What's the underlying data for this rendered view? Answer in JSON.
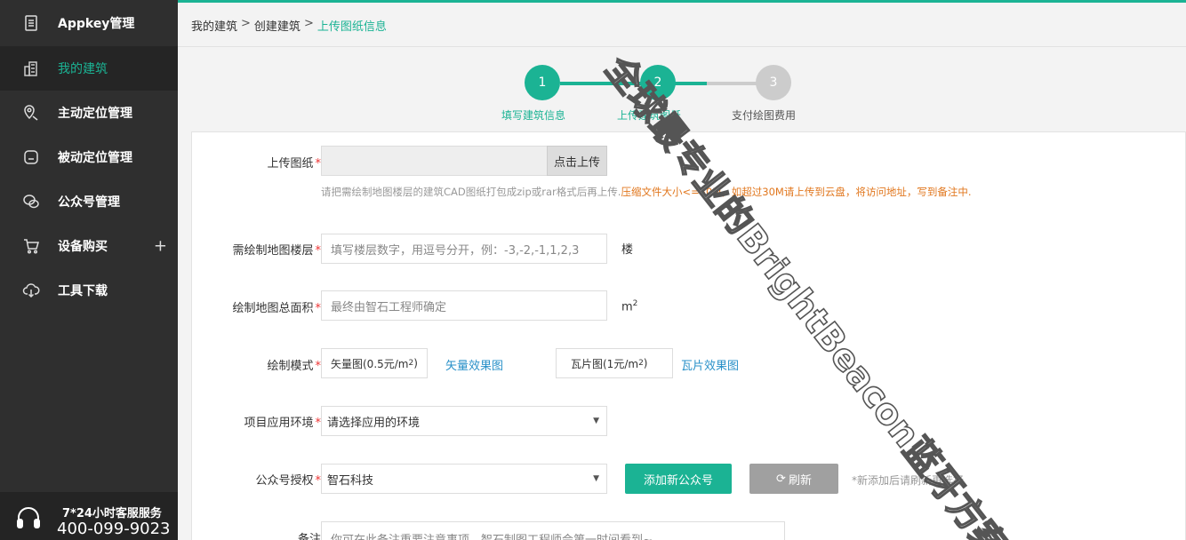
{
  "sidebar": {
    "items": [
      {
        "label": "Appkey管理",
        "icon": "document-icon"
      },
      {
        "label": "我的建筑",
        "icon": "building-icon"
      },
      {
        "label": "主动定位管理",
        "icon": "location-pin-icon"
      },
      {
        "label": "被动定位管理",
        "icon": "beacon-device-icon"
      },
      {
        "label": "公众号管理",
        "icon": "wechat-icon"
      },
      {
        "label": "设备购买",
        "icon": "cart-icon",
        "expand": "+"
      },
      {
        "label": "工具下载",
        "icon": "cloud-download-icon"
      }
    ],
    "service": {
      "title": "7*24小时客服服务",
      "phone": "400-099-9023"
    }
  },
  "breadcrumb": {
    "items": [
      "我的建筑",
      "创建建筑"
    ],
    "separator": ">",
    "current": "上传图纸信息"
  },
  "steps": [
    {
      "number": "1",
      "label": "填写建筑信息",
      "status": "done"
    },
    {
      "number": "2",
      "label": "上传建筑图纸",
      "status": "active"
    },
    {
      "number": "3",
      "label": "支付绘图费用",
      "status": "pending"
    }
  ],
  "form": {
    "upload": {
      "label": "上传图纸",
      "required": "*",
      "button": "点击上传",
      "hint": "请把需绘制地图楼层的建筑CAD图纸打包成zip或rar格式后再上传.",
      "hint_warn": "压缩文件大小<=30M，如超过30M请上传到云盘，将访问地址，写到备注中."
    },
    "floors": {
      "label": "需绘制地图楼层",
      "required": "*",
      "placeholder": "填写楼层数字，用逗号分开，例：-3,-2,-1,1,2,3",
      "unit": "楼"
    },
    "area": {
      "label": "绘制地图总面积",
      "required": "*",
      "placeholder": "最终由智石工程师确定",
      "unit": "m",
      "unit_sup": "2"
    },
    "mode": {
      "label": "绘制模式",
      "required": "*",
      "vector": "矢量图(0.5元/m",
      "vector_sup": "2",
      "vector_close": ")",
      "vector_link": "矢量效果图",
      "tile": "瓦片图(1元/m",
      "tile_sup": "2",
      "tile_close": ")",
      "tile_link": "瓦片效果图"
    },
    "env": {
      "label": "项目应用环境",
      "required": "*",
      "selected": "请选择应用的环境",
      "arrow": "▼"
    },
    "wechat": {
      "label": "公众号授权",
      "required": "*",
      "selected": "智石科技",
      "arrow": "▼",
      "add_button": "添加新公众号",
      "refresh_button": "刷新",
      "hint": "*新添加后请刷新再选择"
    },
    "remark": {
      "label": "备注",
      "placeholder": "你可在此备注重要注意事项，智石制图工程师会第一时间看到~"
    }
  },
  "watermark": "全球最专业的BrightBeacon蓝牙方案解决商",
  "colors": {
    "accent": "#1bb394",
    "sidebar": "#2f2f2f",
    "link": "#2a91c9",
    "warn": "#e1771e",
    "required": "#e33333"
  }
}
